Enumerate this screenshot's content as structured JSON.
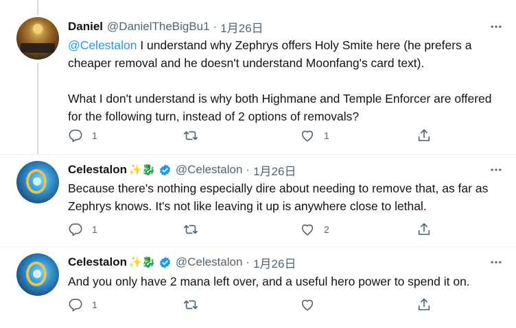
{
  "colors": {
    "link": "#1d9bf0",
    "muted": "#536471",
    "text": "#0f1419",
    "verified": "#1d9bf0",
    "thread_line": "#cfd9de"
  },
  "tweets": [
    {
      "author_name": "Daniel",
      "author_emoji": "",
      "verified": false,
      "handle": "@DanielTheBigBu1",
      "separator": "·",
      "date": "1月26日",
      "mention": "@Celestalon",
      "text": " I understand why Zephrys offers Holy Smite here (he prefers a cheaper removal and he doesn't understand Moonfang's card text).\n\nWhat I don't understand is why both Highmane and Temple Enforcer are offered for the following turn, instead of 2 options of removals?",
      "reply_count": "1",
      "retweet_count": "",
      "like_count": "1",
      "avatar_icon": "hearthstone-card-avatar"
    },
    {
      "author_name": "Celestalon",
      "author_emoji": "✨🐉",
      "verified": true,
      "handle": "@Celestalon",
      "separator": "·",
      "date": "1月26日",
      "mention": "",
      "text": "Because there's nothing especially dire about needing to remove that, as far as Zephrys knows. It's not like leaving it up is anywhere close to lethal.",
      "reply_count": "1",
      "retweet_count": "",
      "like_count": "2",
      "avatar_icon": "celestalon-avatar"
    },
    {
      "author_name": "Celestalon",
      "author_emoji": "✨🐉",
      "verified": true,
      "handle": "@Celestalon",
      "separator": "·",
      "date": "1月26日",
      "mention": "",
      "text": "And you only have 2 mana left over, and a useful hero power to spend it on.",
      "reply_count": "1",
      "retweet_count": "",
      "like_count": "",
      "avatar_icon": "celestalon-avatar"
    }
  ]
}
